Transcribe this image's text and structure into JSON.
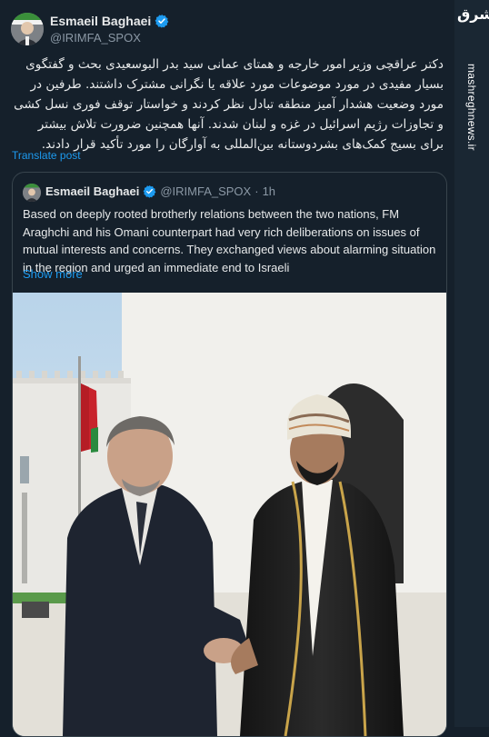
{
  "post": {
    "author_name": "Esmaeil Baghaei",
    "handle": "@IRIMFA_SPOX",
    "text": "دکتر عراقچی وزیر امور خارجه و همتای عمانی سید بدر البوسعیدی بحث و گفتگوی بسیار مفیدی در مورد موضوعات مورد علاقه یا نگرانی مشترک داشتند. طرفین در مورد وضعیت هشدار آمیز منطقه تبادل نظر کردند و خواستار توقف فوری نسل کشی و تجاوزات رژیم اسرائیل در غزه و لبنان شدند. آنها همچنین ضرورت تلاش بیشتر برای بسیج کمک‌های بشردوستانه بین‌المللی به آوارگان را مورد تأکید قرار دادند.",
    "translate_label": "Translate post"
  },
  "quote": {
    "author_name": "Esmaeil Baghaei",
    "handle": "@IRIMFA_SPOX",
    "separator": "·",
    "time": "1h",
    "text": "Based on deeply rooted brotherly relations between the two nations, FM Araghchi and his Omani counterpart had very rich deliberations on issues of mutual interests and concerns. They exchanged views about alarming situation in the region and urged an immediate end to Israeli",
    "show_more_label": "Show more"
  },
  "watermark": {
    "logo_text": "مشرق",
    "url": "mashreghnews.ir"
  },
  "colors": {
    "background": "#15202b",
    "accent": "#1d9bf0",
    "text": "#e7e9ea",
    "muted": "#8b98a5",
    "border": "#38444d"
  },
  "icons": {
    "verified": "verified-badge-icon"
  }
}
